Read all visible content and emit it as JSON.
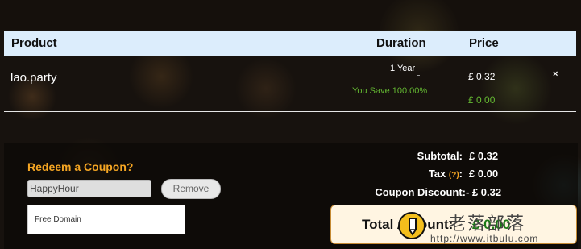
{
  "table": {
    "headers": {
      "product": "Product",
      "duration": "Duration",
      "price": "Price"
    },
    "row": {
      "product": "lao.party",
      "duration": "1 Year",
      "savings": "You Save 100.00%",
      "original_price": "£ 0.32",
      "discounted_price": "£ 0.00",
      "remove_icon": "×"
    }
  },
  "coupon": {
    "title": "Redeem a Coupon?",
    "value": "HappyHour",
    "remove_label": "Remove",
    "dropdown_option": "Free Domain"
  },
  "summary": {
    "subtotal_label": "Subtotal:",
    "subtotal_value": "£ 0.32",
    "tax_label": "Tax",
    "tax_help": "(?)",
    "tax_suffix": ":",
    "tax_value": "£ 0.00",
    "discount_label": "Coupon Discount:",
    "discount_value": "- £ 0.32",
    "total_label": "Total Amount:",
    "total_value": "£ 0.00"
  },
  "watermark": {
    "cn": "老落部落",
    "url": "http://www.itbulu.com",
    "icon": "pencil-icon"
  },
  "colors": {
    "header_bg": "#dcedfc",
    "accent_orange": "#f5a623",
    "savings_green": "#64b832",
    "total_green": "#1a7a16",
    "total_box_bg": "#fff5e2"
  }
}
